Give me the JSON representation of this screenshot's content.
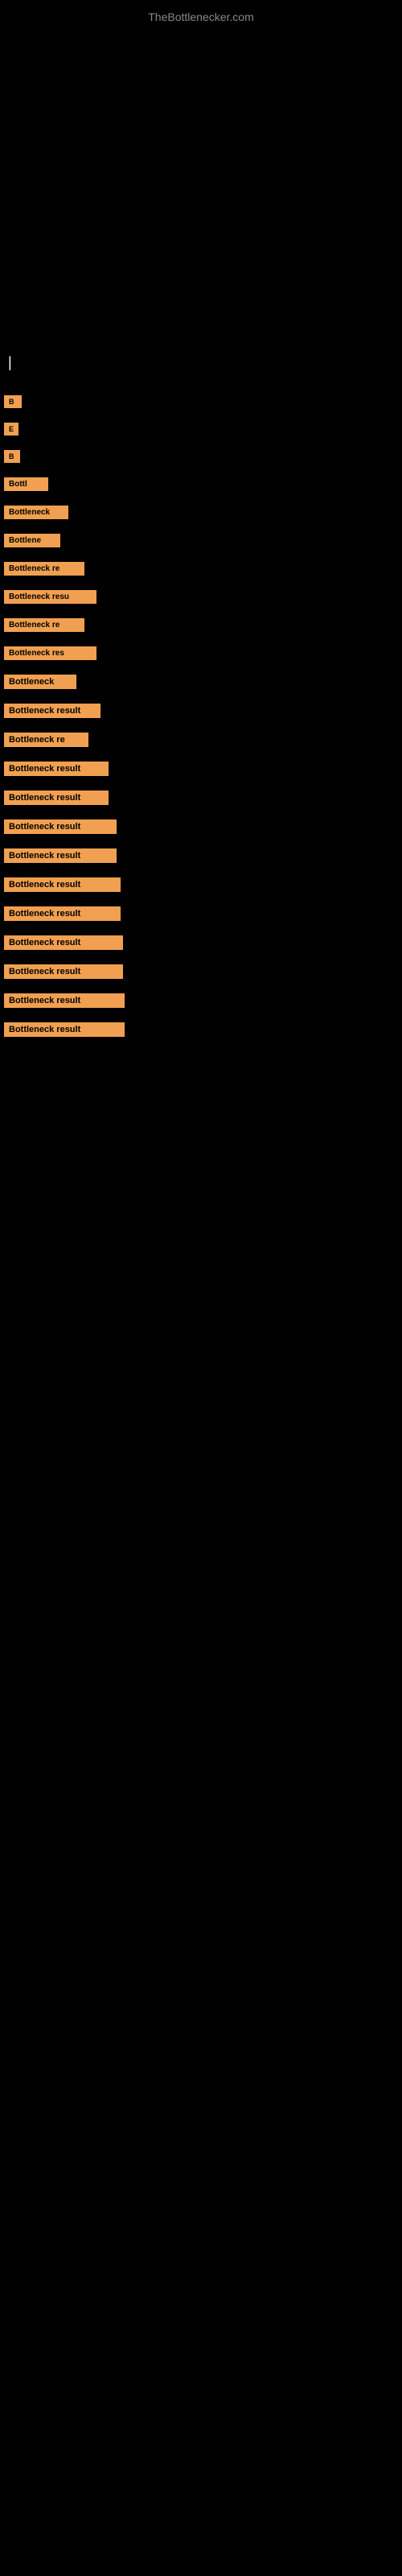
{
  "header": {
    "site_title": "TheBottlenecker.com"
  },
  "cursor": {
    "symbol": "|"
  },
  "results": [
    {
      "label": "B"
    },
    {
      "label": "E"
    },
    {
      "label": "B"
    },
    {
      "label": "Bottl"
    },
    {
      "label": "Bottleneck"
    },
    {
      "label": "Bottlene"
    },
    {
      "label": "Bottleneck re"
    },
    {
      "label": "Bottleneck resu"
    },
    {
      "label": "Bottleneck re"
    },
    {
      "label": "Bottleneck res"
    },
    {
      "label": "Bottleneck"
    },
    {
      "label": "Bottleneck result"
    },
    {
      "label": "Bottleneck re"
    },
    {
      "label": "Bottleneck result"
    },
    {
      "label": "Bottleneck result"
    },
    {
      "label": "Bottleneck result"
    },
    {
      "label": "Bottleneck result"
    },
    {
      "label": "Bottleneck result"
    },
    {
      "label": "Bottleneck result"
    },
    {
      "label": "Bottleneck result"
    },
    {
      "label": "Bottleneck result"
    },
    {
      "label": "Bottleneck result"
    },
    {
      "label": "Bottleneck result"
    }
  ]
}
